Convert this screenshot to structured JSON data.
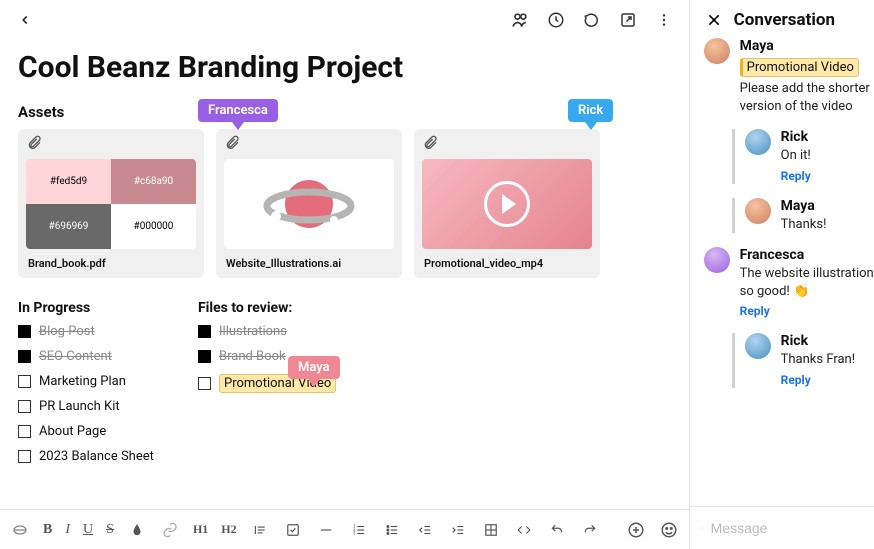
{
  "page_title": "Cool Beanz Branding Project",
  "sections": {
    "assets": "Assets",
    "in_progress": "In Progress",
    "files_to_review": "Files to review:"
  },
  "cursors": {
    "francesca": "Francesca",
    "rick": "Rick",
    "maya": "Maya"
  },
  "assets": [
    {
      "caption": "Brand_book.pdf",
      "swatches": [
        "#fed5d9",
        "#c68a90",
        "#696969",
        "#000000"
      ]
    },
    {
      "caption": "Website_Illustrations.ai"
    },
    {
      "caption": "Promotional_video_mp4"
    }
  ],
  "in_progress": [
    {
      "label": "Blog Post",
      "done": true
    },
    {
      "label": "SEO Content",
      "done": true
    },
    {
      "label": "Marketing Plan",
      "done": false
    },
    {
      "label": "PR Launch Kit",
      "done": false
    },
    {
      "label": "About Page",
      "done": false
    },
    {
      "label": "2023 Balance Sheet",
      "done": false
    }
  ],
  "files_to_review": [
    {
      "label": "Illustrations",
      "done": true,
      "highlight": false
    },
    {
      "label": "Brand Book",
      "done": true,
      "highlight": false
    },
    {
      "label": "Promotional Video",
      "done": false,
      "highlight": true
    }
  ],
  "toolbar": {
    "bold": "B",
    "italic": "I",
    "underline": "U",
    "strike": "S",
    "h1": "H1",
    "h2": "H2"
  },
  "conversation_title": "Conversation",
  "messages": [
    {
      "name": "Maya",
      "highlight": "Promotional Video",
      "text": "Please add the shorter version of the video",
      "avatar": "maya",
      "nested": false,
      "reply": false
    },
    {
      "name": "Rick",
      "text": "On it!",
      "avatar": "rick",
      "nested": true,
      "reply": true
    },
    {
      "name": "Maya",
      "text": "Thanks!",
      "avatar": "maya",
      "nested": true,
      "reply": false
    },
    {
      "name": "Francesca",
      "text": "The website illustrations look so good! 👏",
      "avatar": "fran",
      "nested": false,
      "reply": true
    },
    {
      "name": "Rick",
      "text": "Thanks Fran!",
      "avatar": "rick",
      "nested": true,
      "reply": true
    }
  ],
  "reply_label": "Reply",
  "message_placeholder": "Message"
}
